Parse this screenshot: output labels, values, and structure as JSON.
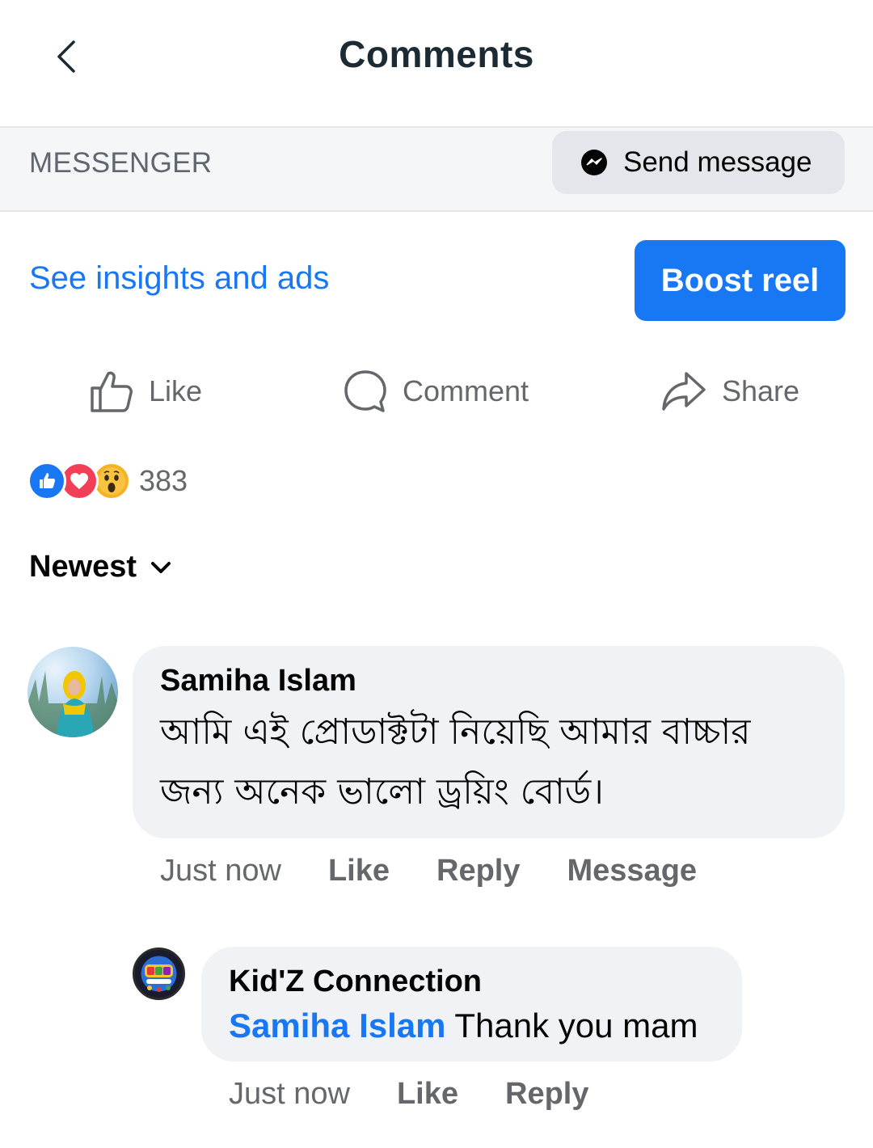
{
  "header": {
    "title": "Comments",
    "back_icon": "chevron-left-icon"
  },
  "messenger": {
    "label": "MESSENGER",
    "send_label": "Send message",
    "icon": "messenger-icon"
  },
  "insights": {
    "link_label": "See insights and ads",
    "boost_label": "Boost reel"
  },
  "actions": {
    "like": "Like",
    "comment": "Comment",
    "share": "Share"
  },
  "reactions": {
    "types": [
      "like",
      "love",
      "wow"
    ],
    "count": "383"
  },
  "sort": {
    "label": "Newest"
  },
  "comments": [
    {
      "author": "Samiha Islam",
      "text_line1": "আমি এই প্রোডাক্টটা নিয়েছি আমার বাচ্চার",
      "text_line2": "জন্য অনেক ভালো ড্রয়িং বোর্ড।",
      "time": "Just now",
      "like": "Like",
      "reply": "Reply",
      "message": "Message"
    }
  ],
  "reply": {
    "author": "Kid'Z Connection",
    "mention": "Samiha Islam",
    "text": " Thank you mam",
    "time": "Just now",
    "like": "Like",
    "reply": "Reply"
  },
  "colors": {
    "accent": "#1877f2",
    "secondary_text": "#65676b",
    "bubble": "#f0f2f5"
  }
}
